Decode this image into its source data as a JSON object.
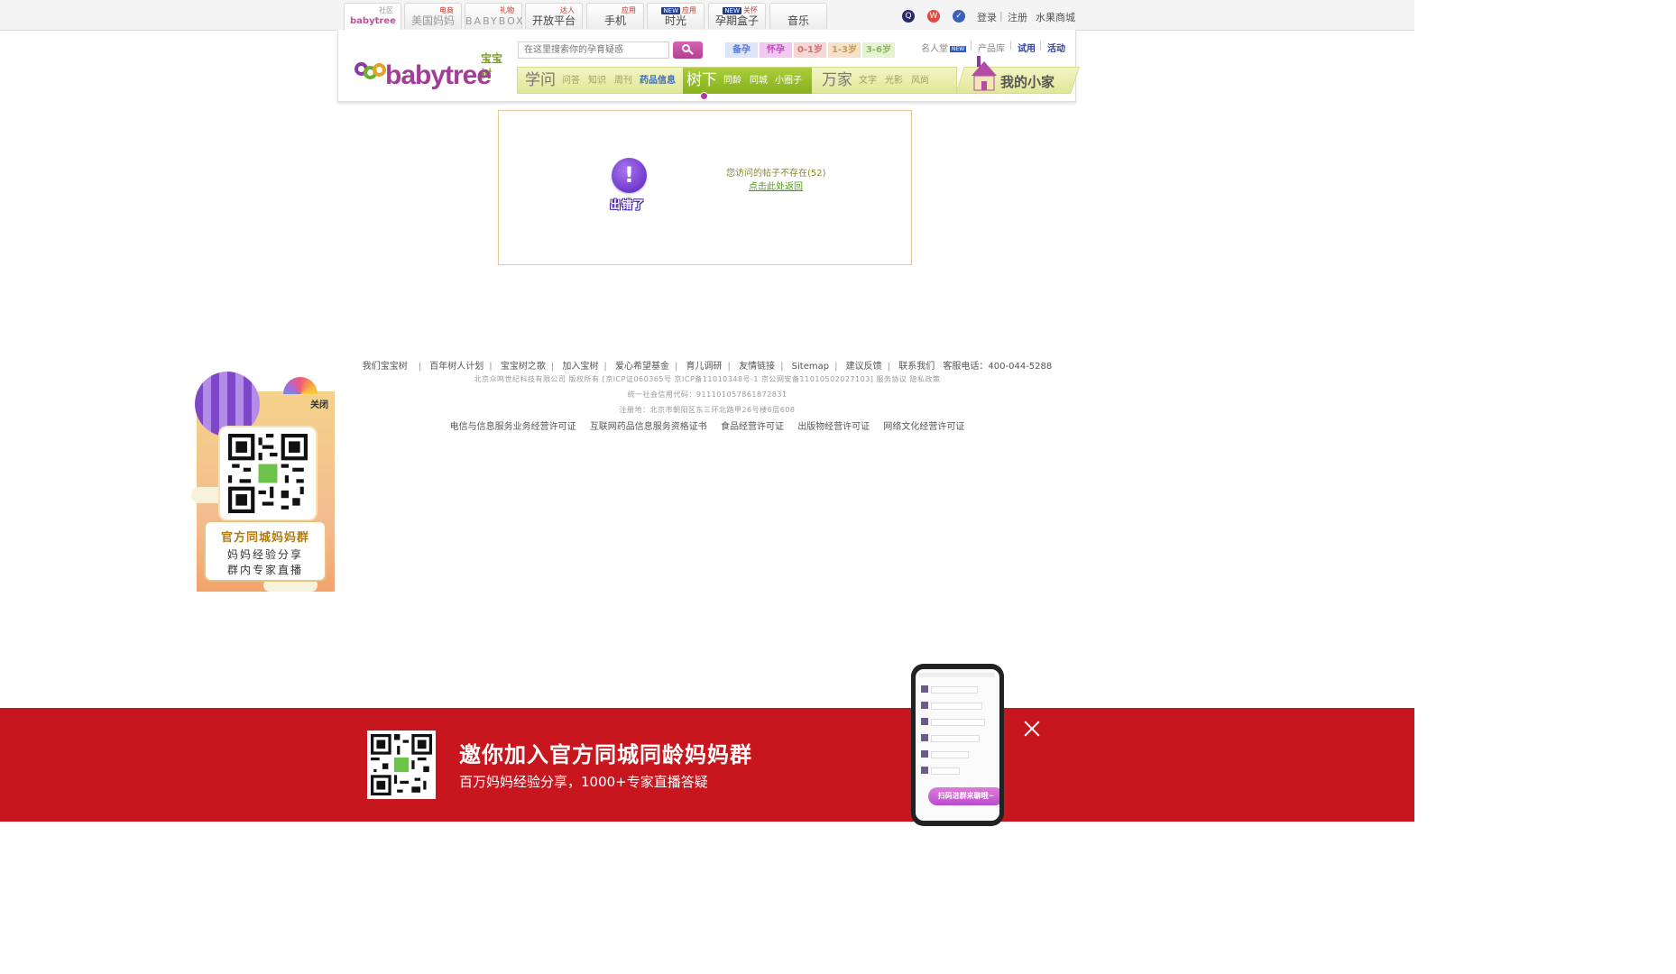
{
  "top_nav": {
    "tabs": [
      {
        "label": "",
        "sup": "社区",
        "logo": "babytree"
      },
      {
        "label": "美国妈妈",
        "sup": "电商"
      },
      {
        "label": "BABYBOX",
        "sup": "礼物"
      },
      {
        "label": "开放平台",
        "sup": "达人"
      },
      {
        "label": "手机",
        "sup": "应用"
      },
      {
        "label": "时光",
        "sup": "应用",
        "new": "NEW"
      },
      {
        "label": "孕期盒子",
        "sup": "关怀",
        "new": "NEW"
      },
      {
        "label": "音乐",
        "sup": ""
      }
    ],
    "right_links": {
      "login": "登录",
      "sep": "|",
      "register": "注册",
      "fruit_mall": "水果商城"
    }
  },
  "header": {
    "logo_zh": "宝宝树",
    "logo_en": "babytree",
    "search_placeholder": "在这里搜索你的孕育疑惑",
    "stages": [
      {
        "label": "备孕",
        "bg": "#dde5fb",
        "color": "#5a7ad8"
      },
      {
        "label": "怀孕",
        "bg": "#f2c9f0",
        "color": "#c24cbf"
      },
      {
        "label": "0-1岁",
        "bg": "#f7d6d6",
        "color": "#d06f6f"
      },
      {
        "label": "1-3岁",
        "bg": "#f6e2c9",
        "color": "#c89a55"
      },
      {
        "label": "3-6岁",
        "bg": "#e5f3d3",
        "color": "#8ab85a"
      }
    ],
    "right_links": {
      "celebrity": "名人堂",
      "new_badge": "NEW",
      "products": "产品库",
      "trial": "试用",
      "events": "活动",
      "sep": "|"
    },
    "nav": {
      "xuewen": "学问",
      "xuewen_items": [
        "问答",
        "知识",
        "周刊",
        "药品信息"
      ],
      "shuxia": "树下",
      "shuxia_items": [
        "同龄",
        "同城",
        "小圈子"
      ],
      "wanjia": "万家",
      "wanjia_items": [
        "文字",
        "光影",
        "风尚"
      ],
      "home": "我的小家"
    }
  },
  "error": {
    "badge": "出错了",
    "message": "您访问的帖子不存在(52)",
    "back_link": "点击此处返回"
  },
  "footer": {
    "links": [
      "我们宝宝树",
      "百年树人计划",
      "宝宝树之歌",
      "加入宝树",
      "爱心希望基金",
      "育儿调研",
      "友情链接",
      "Sitemap",
      "建议反馈",
      "联系我们"
    ],
    "hotline": "客服电话：400-044-5288",
    "copyright": "北京众鸣世纪科技有限公司 版权所有 [京ICP证060365号 京ICP备11010348号-1 京公网安备11010502027103] 服务协议 隐私政策",
    "credit_code": "统一社会信用代码：911101057861872831",
    "address": "注册地：北京市朝阳区东三环北路甲26号楼6层608",
    "licenses": [
      "电信与信息服务业务经营许可证",
      "互联网药品信息服务资格证书",
      "食品经营许可证",
      "出版物经营许可证",
      "网络文化经营许可证"
    ]
  },
  "side_ad": {
    "close": "关闭",
    "line1": "官方同城妈妈群",
    "line2": "妈妈经验分享",
    "line3": "群内专家直播"
  },
  "bottom_banner": {
    "title": "邀你加入官方同城同龄妈妈群",
    "subtitle": "百万妈妈经验分享，1000+专家直播答疑",
    "phone_cta": "扫码进群来聊哦~"
  }
}
